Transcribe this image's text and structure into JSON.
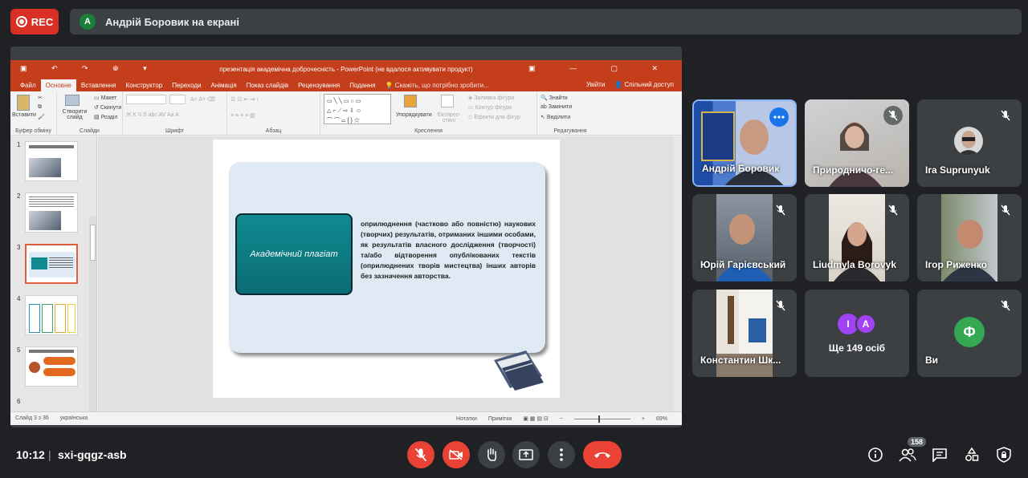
{
  "recording": {
    "label": "REC"
  },
  "presenter": {
    "initial": "А",
    "text": "Андрій Боровик на екрані"
  },
  "powerpoint": {
    "title": "презентація академічна доброчесність - PowerPoint (не вдалося активувати продукт)",
    "tabs": [
      "Файл",
      "Основне",
      "Вставлення",
      "Конструктор",
      "Переходи",
      "Анімація",
      "Показ слайдів",
      "Рецензування",
      "Подання"
    ],
    "tell_me": "Скажіть, що потрібно зробити...",
    "right_tabs": {
      "signin": "Увійти",
      "share": "Спільний доступ"
    },
    "ribbon": {
      "paste": "Вставити",
      "clipboard": "Буфер обміну",
      "new_slide": "Створити слайд",
      "layout": "Макет",
      "reset": "Скинути",
      "section": "Розділ",
      "slides_group": "Слайди",
      "font_group": "Шрифт",
      "paragraph_group": "Абзац",
      "arrange": "Упорядкувати",
      "quick_styles": "Експрес-стилі",
      "fill": "Заливка фігури",
      "outline": "Контур фігури",
      "effects": "Ефекти для фігур",
      "drawing_group": "Креслення",
      "find": "Знайти",
      "replace": "Замінити",
      "select": "Виділити",
      "editing_group": "Редагування"
    },
    "thumbnails": [
      "1",
      "2",
      "3",
      "4",
      "5",
      "6"
    ],
    "active_thumbnail": 3,
    "slide": {
      "box_text": "Академічний плагіат",
      "body": "оприлюднення (частково або повністю) наукових (творчих) результатів, отриманих іншими особами, як результатів власного дослідження (творчості) та/або відтворення опублікованих текстів (оприлюднених творів мистецтва) інших авторів без зазначення авторства."
    },
    "status": {
      "slide": "Слайд 3 з 36",
      "language": "українська",
      "notes": "Нотатки",
      "comments": "Примітки",
      "zoom": "69%"
    }
  },
  "participants": [
    {
      "name": "Андрій Боровик",
      "active": true
    },
    {
      "name": "Природничо-ге..."
    },
    {
      "name": "Ira Suprunyuk"
    },
    {
      "name": "Юрій Гарієвський"
    },
    {
      "name": "Liudmyla Borovyk"
    },
    {
      "name": "Ігор Риженко"
    },
    {
      "name": "Константин Шк..."
    },
    {
      "name": "Ще 149 осіб",
      "initials": [
        "І",
        "А"
      ]
    },
    {
      "name": "Ви",
      "initial": "Ф"
    }
  ],
  "bottom": {
    "time": "10:12",
    "separator": "|",
    "meeting_code": "sxi-gqgz-asb",
    "people_count": "158"
  },
  "colors": {
    "rec": "#d93025",
    "ppt_accent": "#c43e1c",
    "slide_box": "#0f8a90",
    "hangup": "#ea4335",
    "self_avatar": "#34a853",
    "other_avatar": "#a142f4"
  }
}
